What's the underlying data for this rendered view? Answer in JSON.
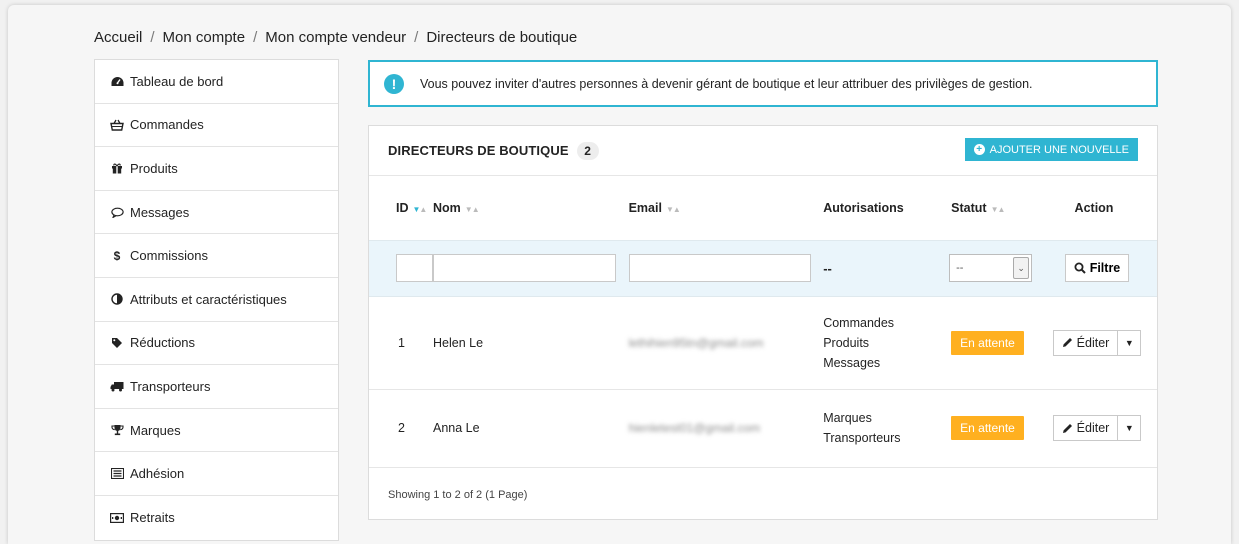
{
  "breadcrumb": {
    "items": [
      "Accueil",
      "Mon compte",
      "Mon compte vendeur",
      "Directeurs de boutique"
    ],
    "separator": "/"
  },
  "sidebar": {
    "items": [
      {
        "label": "Tableau de bord",
        "icon": "dashboard-icon"
      },
      {
        "label": "Commandes",
        "icon": "basket-icon"
      },
      {
        "label": "Produits",
        "icon": "gift-icon"
      },
      {
        "label": "Messages",
        "icon": "comment-icon"
      },
      {
        "label": "Commissions",
        "icon": "dollar-icon"
      },
      {
        "label": "Attributs et caractéristiques",
        "icon": "adjust-icon"
      },
      {
        "label": "Réductions",
        "icon": "tag-icon"
      },
      {
        "label": "Transporteurs",
        "icon": "truck-icon"
      },
      {
        "label": "Marques",
        "icon": "trophy-icon"
      },
      {
        "label": "Adhésion",
        "icon": "list-icon"
      },
      {
        "label": "Retraits",
        "icon": "money-icon"
      }
    ]
  },
  "alert": {
    "icon": "exclamation-icon",
    "text": "Vous pouvez inviter d'autres personnes à devenir gérant de boutique et leur attribuer des privilèges de gestion."
  },
  "panel": {
    "title": "DIRECTEURS DE BOUTIQUE",
    "count": "2",
    "add_label": "AJOUTER UNE NOUVELLE"
  },
  "table": {
    "headers": {
      "id": "ID",
      "name": "Nom",
      "email": "Email",
      "permissions": "Autorisations",
      "status": "Statut",
      "action": "Action"
    },
    "filter": {
      "permissions_placeholder": "--",
      "status_selected": "--",
      "filter_label": "Filtre"
    },
    "rows": [
      {
        "id": "1",
        "name": "Helen Le",
        "email": "lethihien95tn@gmail.com",
        "permissions": [
          "Commandes",
          "Produits",
          "Messages"
        ],
        "status": "En attente",
        "action": "Éditer"
      },
      {
        "id": "2",
        "name": "Anna Le",
        "email": "hienletest01@gmail.com",
        "permissions": [
          "Marques",
          "Transporteurs"
        ],
        "status": "En attente",
        "action": "Éditer"
      }
    ],
    "footer": "Showing 1 to 2 of 2 (1 Page)"
  },
  "colors": {
    "accent": "#2fb5d2",
    "status_pending": "#ffb020"
  }
}
